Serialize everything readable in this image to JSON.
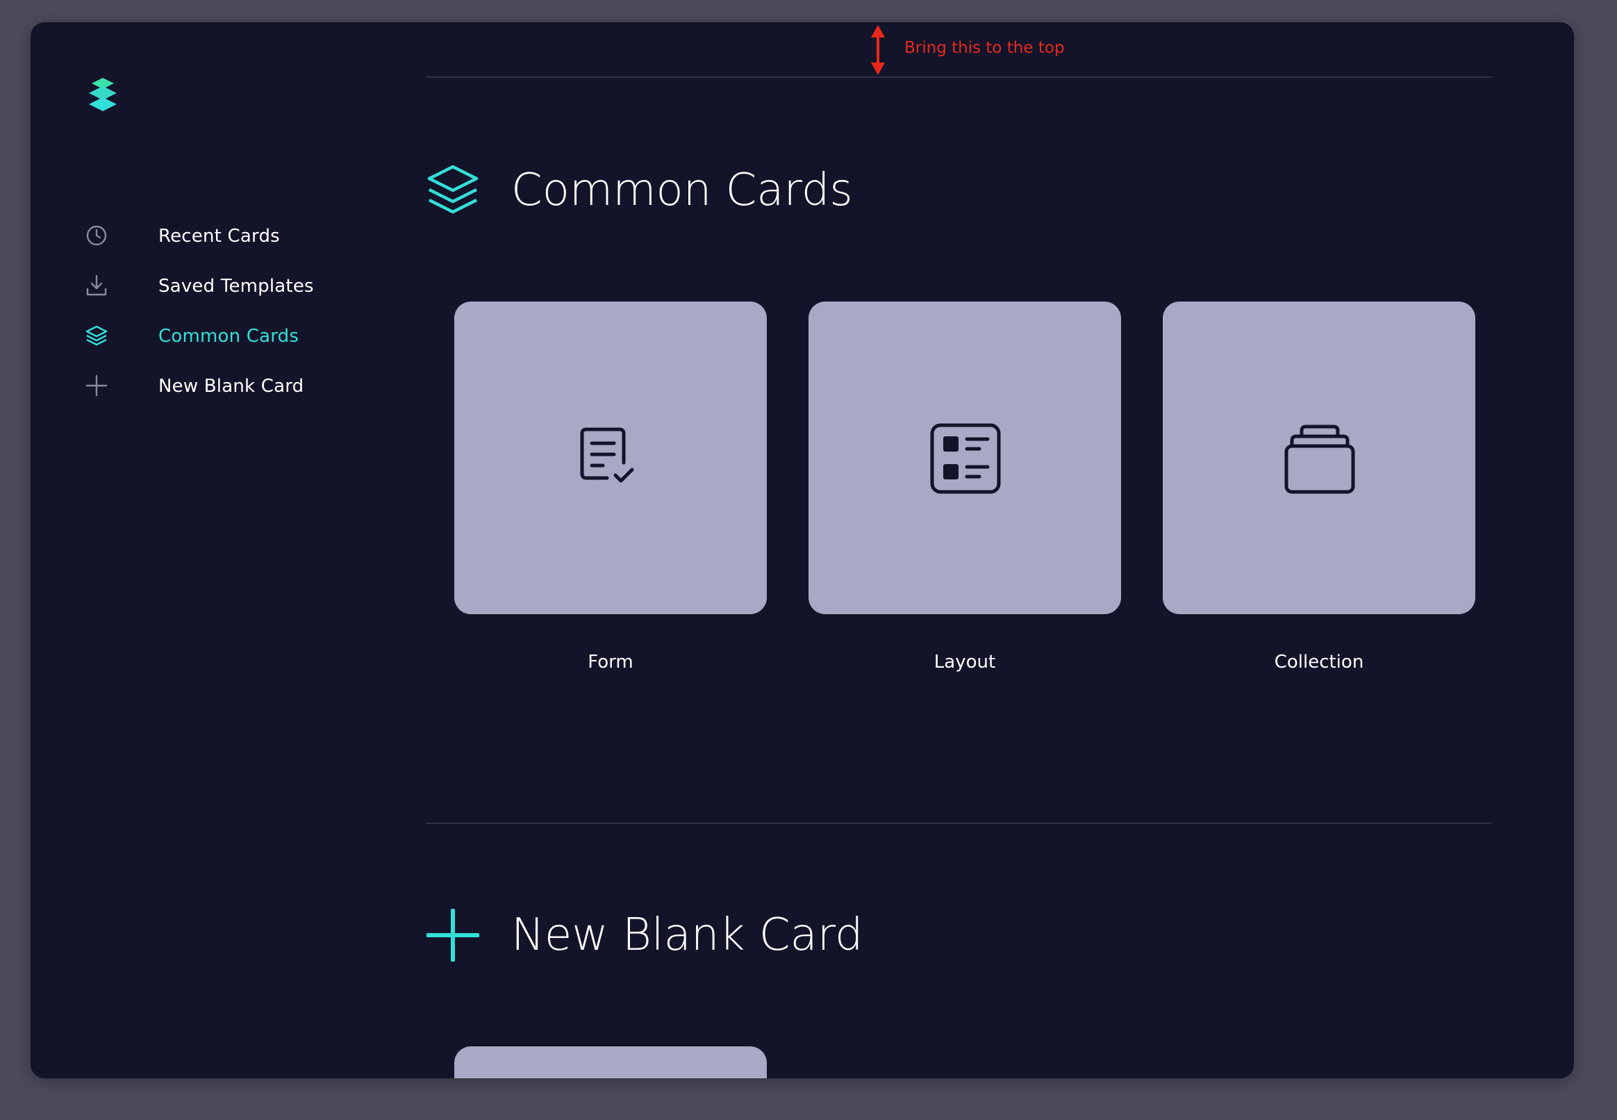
{
  "colors": {
    "accent": "#33e0d9",
    "background": "#131429",
    "card": "#a9a9c6",
    "annotation": "#e8281c"
  },
  "logo": {
    "icon": "layers-logo-icon"
  },
  "sidebar": {
    "items": [
      {
        "label": "Recent Cards",
        "icon": "clock-icon",
        "active": false
      },
      {
        "label": "Saved Templates",
        "icon": "download-icon",
        "active": false
      },
      {
        "label": "Common Cards",
        "icon": "layers-icon",
        "active": true
      },
      {
        "label": "New Blank Card",
        "icon": "plus-icon",
        "active": false
      }
    ]
  },
  "annotation": {
    "text": "Bring this to the top"
  },
  "sections": {
    "common_cards": {
      "title": "Common Cards",
      "icon": "layers-icon",
      "cards": [
        {
          "label": "Form",
          "icon": "form-document-check-icon"
        },
        {
          "label": "Layout",
          "icon": "layout-list-icon"
        },
        {
          "label": "Collection",
          "icon": "collection-stack-icon"
        }
      ]
    },
    "new_blank_card": {
      "title": "New Blank Card",
      "icon": "plus-icon"
    }
  }
}
